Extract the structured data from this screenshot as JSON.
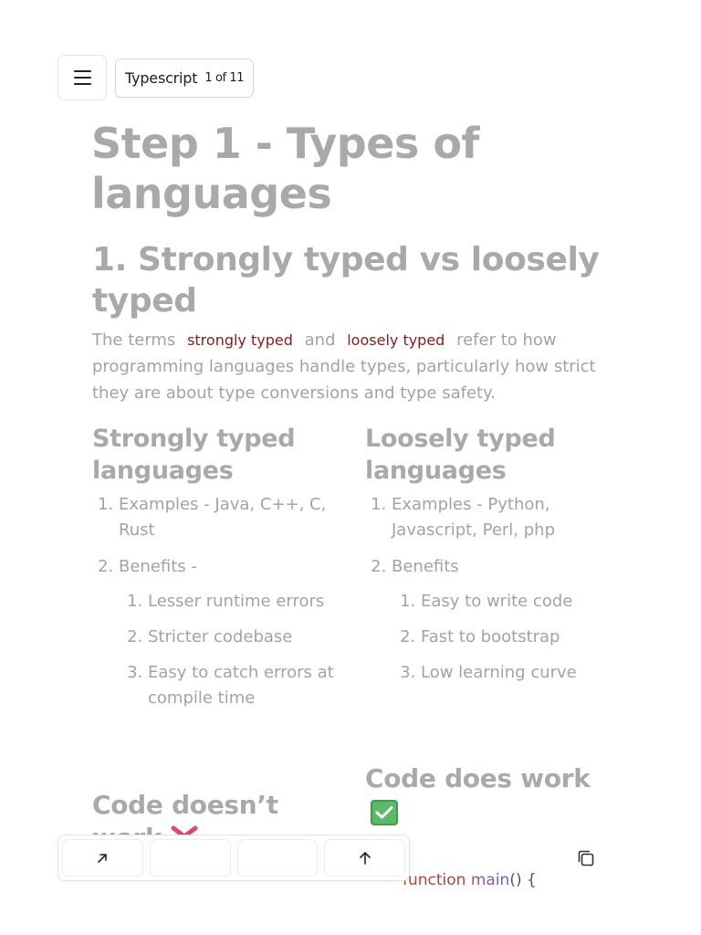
{
  "header": {
    "doc_title": "Typescript",
    "doc_counter": "1 of 11"
  },
  "main": {
    "title": "Step 1 - Types of languages",
    "section_title": "1. Strongly typed vs loosely typed",
    "intro": {
      "prefix": "The terms",
      "term1": "strongly typed",
      "middle": "and",
      "term2": "loosely typed",
      "suffix": "refer to how programming languages handle types, particularly how strict they are about type conversions and type safety."
    },
    "strongly": {
      "heading": "Strongly typed languages",
      "examples": "Examples - Java, C++, C, Rust",
      "benefits_label": "Benefits -",
      "benefits": [
        "Lesser runtime errors",
        "Stricter codebase",
        "Easy to catch errors at compile time"
      ]
    },
    "loosely": {
      "heading": "Loosely typed languages",
      "examples": "Examples - Python, Javascript, Perl, php",
      "benefits_label": "Benefits",
      "benefits": [
        "Easy to write code",
        "Fast to bootstrap",
        "Low learning curve"
      ]
    },
    "code_doesnt_work": "Code doesn’t work",
    "code_does_work": "Code does work",
    "code_line": {
      "keyword": "function",
      "name": "main",
      "rest": "() {"
    }
  },
  "icons": {
    "menu": "hamburger-icon",
    "expand": "arrow-up-right-icon",
    "scroll_top": "arrow-up-icon",
    "copy": "copy-icon",
    "check": "check-mark-icon",
    "cross": "cross-mark-icon"
  },
  "colors": {
    "inline_code": "#8c1a1a",
    "check_green": "#5bb96a",
    "cross_pink": "#e0457b"
  }
}
